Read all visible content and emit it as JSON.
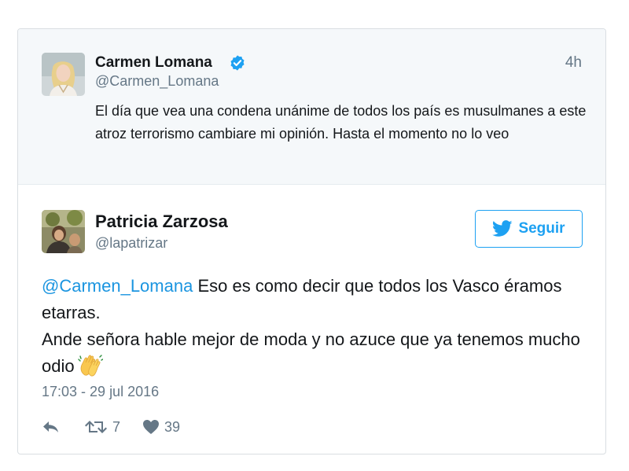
{
  "parent_tweet": {
    "author_name": "Carmen Lomana",
    "handle": "@Carmen_Lomana",
    "time": "4h",
    "text": "El día que vea una condena unánime de todos los país es musulmanes a este atroz terrorismo cambiare mi opinión. Hasta el momento no lo veo",
    "verified": true,
    "icons": {
      "verified": "verified-badge-icon"
    }
  },
  "reply_tweet": {
    "author_name": "Patricia Zarzosa",
    "handle": "@lapatrizar",
    "follow_label": "Seguir",
    "mention": "@Carmen_Lomana",
    "text_line_1": " Eso es como decir que todos los Vasco éramos etarras.",
    "text_line_2": "Ande señora hable mejor de moda y no azuce que ya tenemos mucho odio",
    "emoji": "waving-hands-emoji",
    "date": "17:03 - 29 jul 2016",
    "retweet_count": "7",
    "like_count": "39",
    "icons": {
      "reply": "reply-icon",
      "retweet": "retweet-icon",
      "like": "heart-icon",
      "bird": "twitter-bird-icon"
    }
  },
  "colors": {
    "accent": "#1da1f2",
    "mention": "#1b95e0",
    "secondary_text": "#657786",
    "parent_background": "#f5f8fa"
  }
}
